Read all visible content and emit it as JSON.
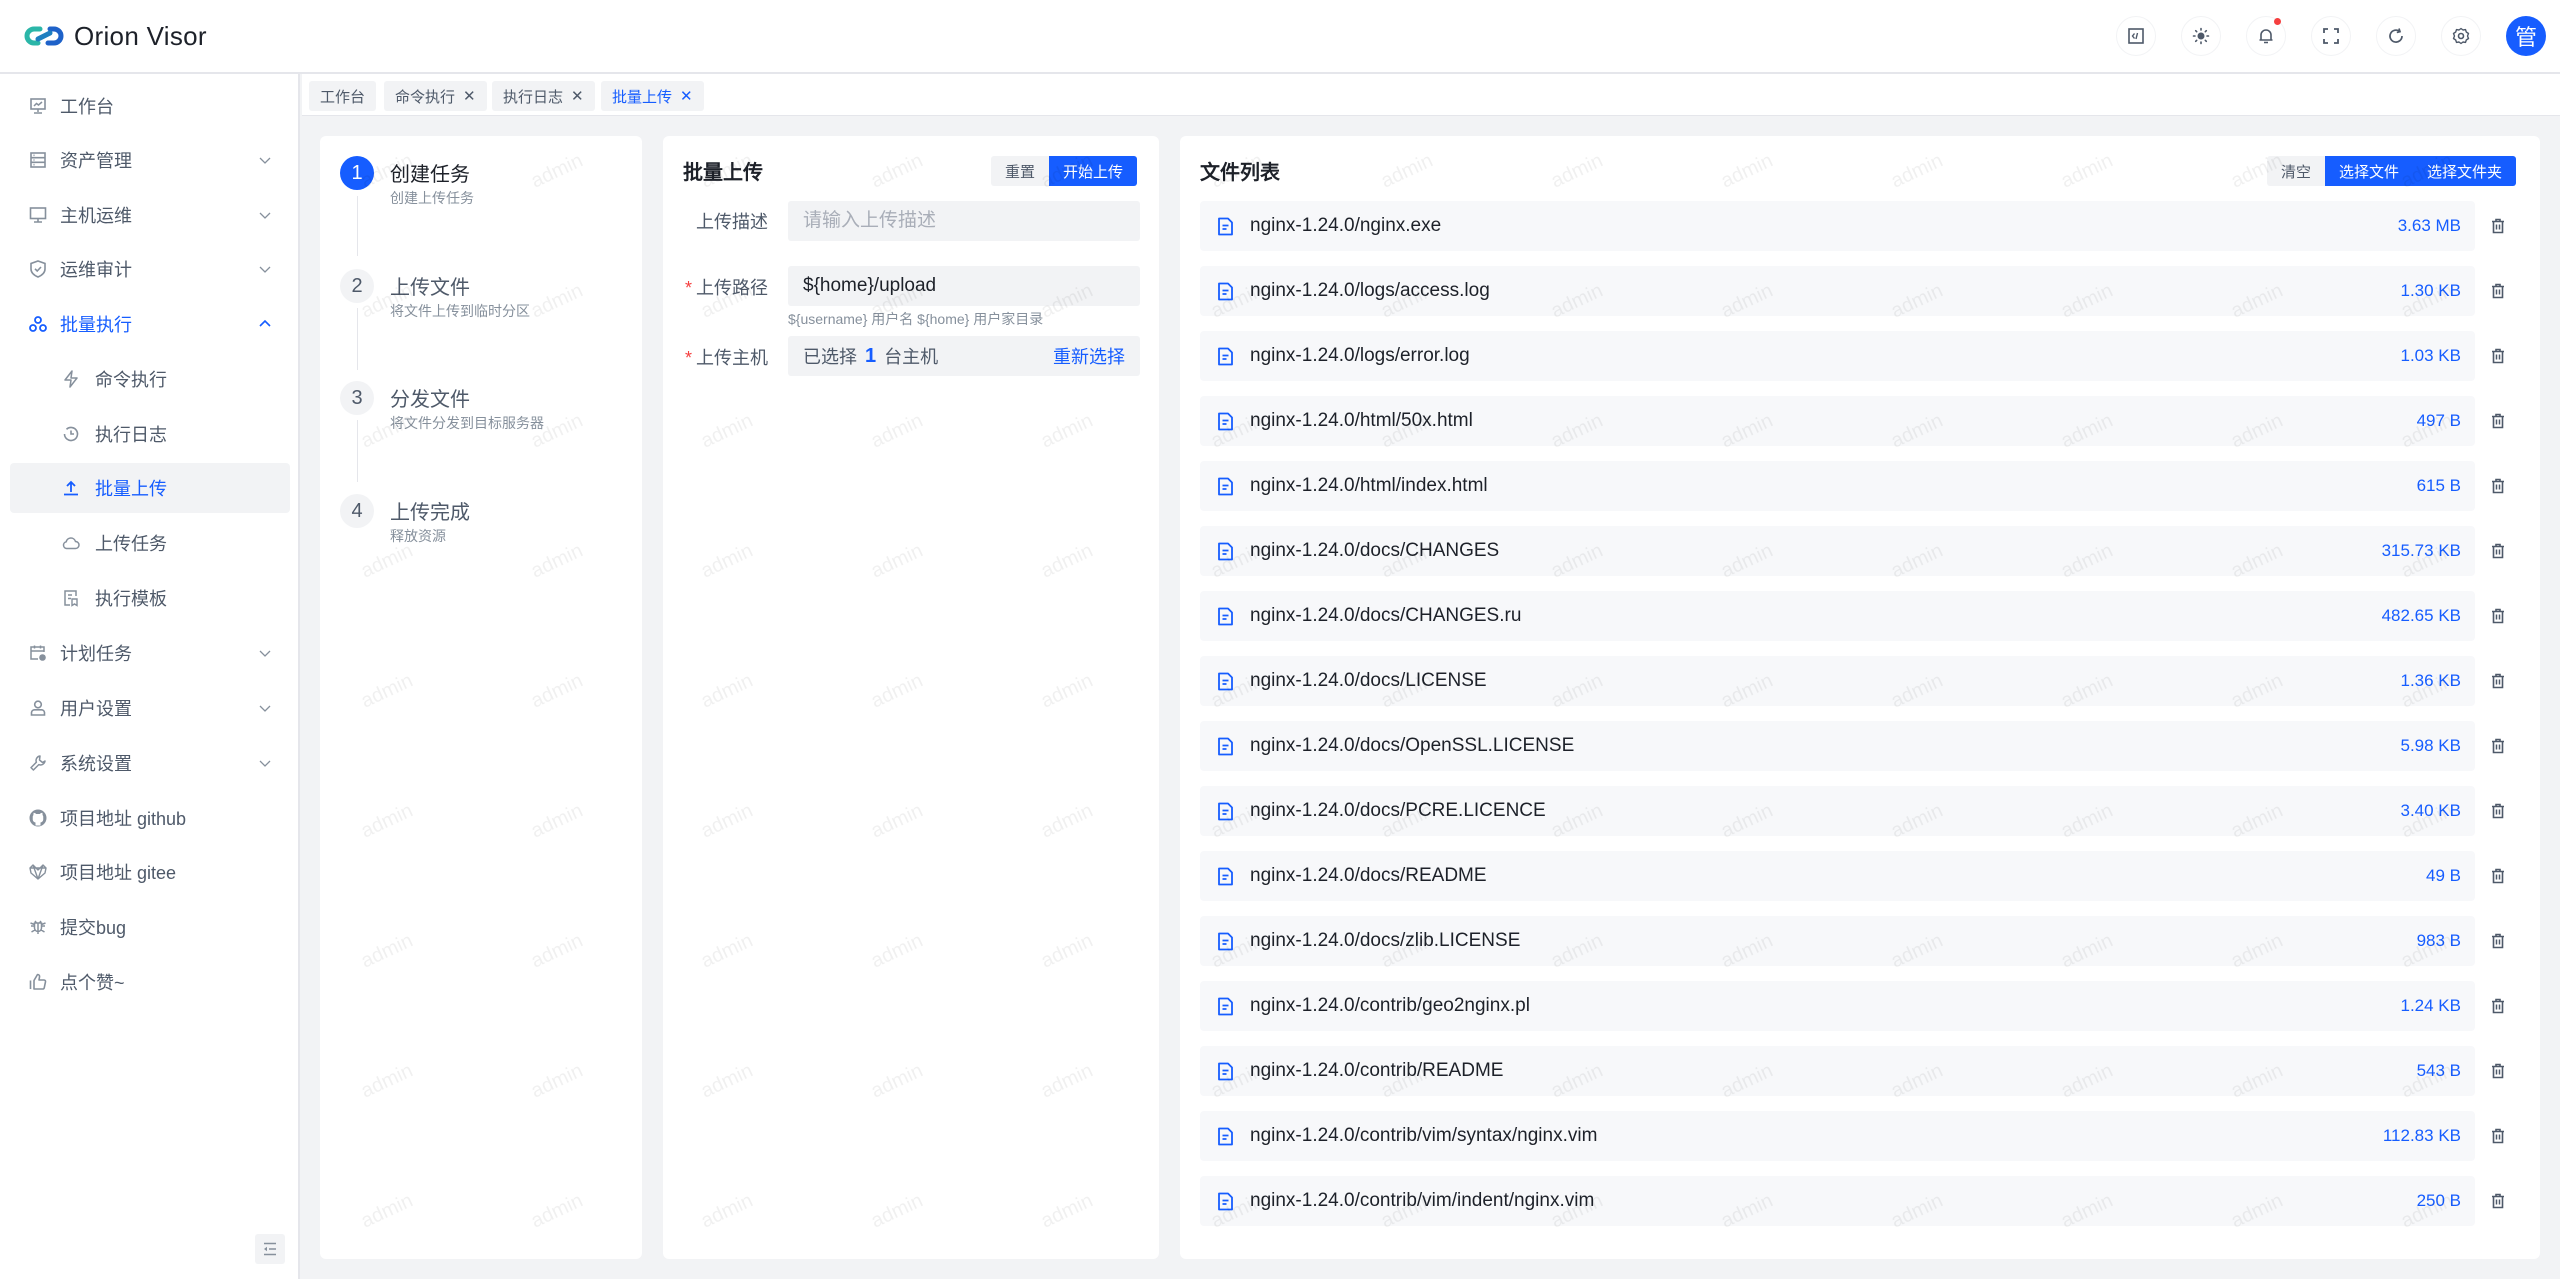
{
  "app": {
    "title": "Orion Visor"
  },
  "header": {
    "actions": [
      {
        "name": "code-editor-icon"
      },
      {
        "name": "theme-toggle-icon"
      },
      {
        "name": "notification-bell-icon",
        "has_badge": true
      },
      {
        "name": "fullscreen-icon"
      },
      {
        "name": "refresh-icon"
      },
      {
        "name": "settings-gear-icon"
      }
    ],
    "avatar_text": "管",
    "accent_color": "#165dff"
  },
  "sidebar": {
    "items": [
      {
        "label": "工作台",
        "icon": "dashboard-icon"
      },
      {
        "label": "资产管理",
        "icon": "asset-icon",
        "expandable": true
      },
      {
        "label": "主机运维",
        "icon": "monitor-icon",
        "expandable": true
      },
      {
        "label": "运维审计",
        "icon": "shield-icon",
        "expandable": true
      },
      {
        "label": "批量执行",
        "icon": "batch-icon",
        "expandable": true,
        "expanded": true,
        "active": true,
        "children": [
          {
            "label": "命令执行",
            "icon": "lightning-icon"
          },
          {
            "label": "执行日志",
            "icon": "history-icon"
          },
          {
            "label": "批量上传",
            "icon": "upload-icon",
            "selected": true
          },
          {
            "label": "上传任务",
            "icon": "cloud-icon"
          },
          {
            "label": "执行模板",
            "icon": "template-icon"
          }
        ]
      },
      {
        "label": "计划任务",
        "icon": "calendar-clock-icon",
        "expandable": true
      },
      {
        "label": "用户设置",
        "icon": "user-icon",
        "expandable": true
      },
      {
        "label": "系统设置",
        "icon": "wrench-icon",
        "expandable": true
      },
      {
        "label": "项目地址 github",
        "icon": "github-icon"
      },
      {
        "label": "项目地址 gitee",
        "icon": "gitee-icon"
      },
      {
        "label": "提交bug",
        "icon": "bug-icon"
      },
      {
        "label": "点个赞~",
        "icon": "thumbs-up-icon"
      }
    ]
  },
  "tabs": [
    {
      "label": "工作台",
      "closable": false
    },
    {
      "label": "命令执行",
      "closable": true
    },
    {
      "label": "执行日志",
      "closable": true
    },
    {
      "label": "批量上传",
      "closable": true,
      "active": true
    }
  ],
  "close_glyph": "✕",
  "steps": [
    {
      "num": "1",
      "title": "创建任务",
      "desc": "创建上传任务",
      "current": true
    },
    {
      "num": "2",
      "title": "上传文件",
      "desc": "将文件上传到临时分区"
    },
    {
      "num": "3",
      "title": "分发文件",
      "desc": "将文件分发到目标服务器"
    },
    {
      "num": "4",
      "title": "上传完成",
      "desc": "释放资源"
    }
  ],
  "form": {
    "title": "批量上传",
    "reset_label": "重置",
    "start_label": "开始上传",
    "desc_label": "上传描述",
    "desc_placeholder": "请输入上传描述",
    "desc_value": "",
    "path_label": "上传路径",
    "path_value": "${home}/upload",
    "path_help": "${username} 用户名 ${home} 用户家目录",
    "host_label": "上传主机",
    "host_prefix": "已选择",
    "host_count": "1",
    "host_suffix": "台主机",
    "host_reselect": "重新选择",
    "required_mark": "*"
  },
  "file_list": {
    "title": "文件列表",
    "clear_label": "清空",
    "select_file_label": "选择文件",
    "select_folder_label": "选择文件夹",
    "files": [
      {
        "name": "nginx-1.24.0/nginx.exe",
        "size": "3.63 MB"
      },
      {
        "name": "nginx-1.24.0/logs/access.log",
        "size": "1.30 KB"
      },
      {
        "name": "nginx-1.24.0/logs/error.log",
        "size": "1.03 KB"
      },
      {
        "name": "nginx-1.24.0/html/50x.html",
        "size": "497 B"
      },
      {
        "name": "nginx-1.24.0/html/index.html",
        "size": "615 B"
      },
      {
        "name": "nginx-1.24.0/docs/CHANGES",
        "size": "315.73 KB"
      },
      {
        "name": "nginx-1.24.0/docs/CHANGES.ru",
        "size": "482.65 KB"
      },
      {
        "name": "nginx-1.24.0/docs/LICENSE",
        "size": "1.36 KB"
      },
      {
        "name": "nginx-1.24.0/docs/OpenSSL.LICENSE",
        "size": "5.98 KB"
      },
      {
        "name": "nginx-1.24.0/docs/PCRE.LICENCE",
        "size": "3.40 KB"
      },
      {
        "name": "nginx-1.24.0/docs/README",
        "size": "49 B"
      },
      {
        "name": "nginx-1.24.0/docs/zlib.LICENSE",
        "size": "983 B"
      },
      {
        "name": "nginx-1.24.0/contrib/geo2nginx.pl",
        "size": "1.24 KB"
      },
      {
        "name": "nginx-1.24.0/contrib/README",
        "size": "543 B"
      },
      {
        "name": "nginx-1.24.0/contrib/vim/syntax/nginx.vim",
        "size": "112.83 KB"
      },
      {
        "name": "nginx-1.24.0/contrib/vim/indent/nginx.vim",
        "size": "250 B"
      }
    ]
  },
  "watermark": "admin"
}
